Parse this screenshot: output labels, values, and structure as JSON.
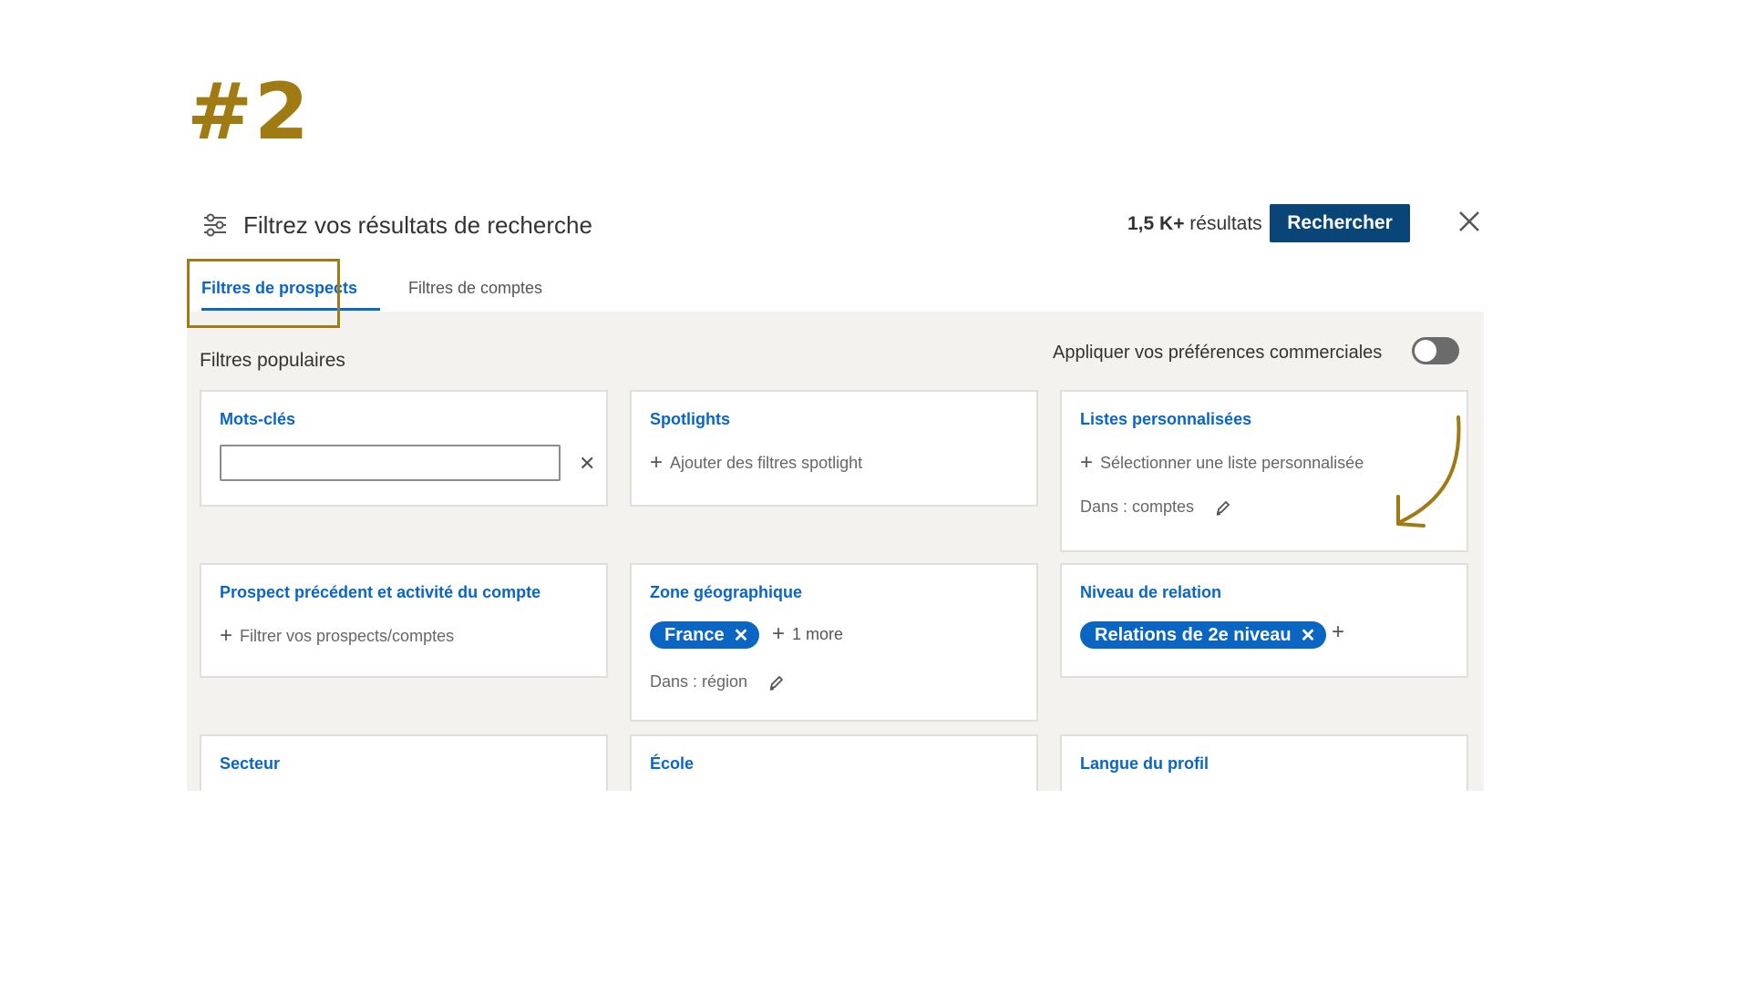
{
  "step": {
    "label": "#2"
  },
  "header": {
    "title": "Filtrez vos résultats de recherche",
    "results_count": "1,5 K+",
    "results_label": " résultats",
    "search_button": "Rechercher"
  },
  "tabs": [
    {
      "label": "Filtres de prospects",
      "active": true
    },
    {
      "label": "Filtres de comptes",
      "active": false
    }
  ],
  "section": {
    "popular_label": "Filtres populaires",
    "preferences_label": "Appliquer vos préférences commerciales",
    "preferences_on": false
  },
  "cards": {
    "keywords": {
      "title": "Mots-clés",
      "value": ""
    },
    "spotlights": {
      "title": "Spotlights",
      "add_label": "Ajouter des filtres spotlight"
    },
    "lists": {
      "title": "Listes personnalisées",
      "add_label": "Sélectionner une liste personnalisée",
      "scope": "Dans : comptes"
    },
    "previous": {
      "title": "Prospect précédent et activité du compte",
      "add_label": "Filtrer vos prospects/comptes"
    },
    "geo": {
      "title": "Zone géographique",
      "pill": "France",
      "more": "1 more",
      "scope": "Dans : région"
    },
    "relation": {
      "title": "Niveau de relation",
      "pill": "Relations de 2e niveau"
    },
    "sector": {
      "title": "Secteur"
    },
    "school": {
      "title": "École"
    },
    "language": {
      "title": "Langue du profil"
    }
  },
  "colors": {
    "accent_gold": "#a07a13",
    "primary_blue": "#0a66c2",
    "button_navy": "#0a4577"
  }
}
